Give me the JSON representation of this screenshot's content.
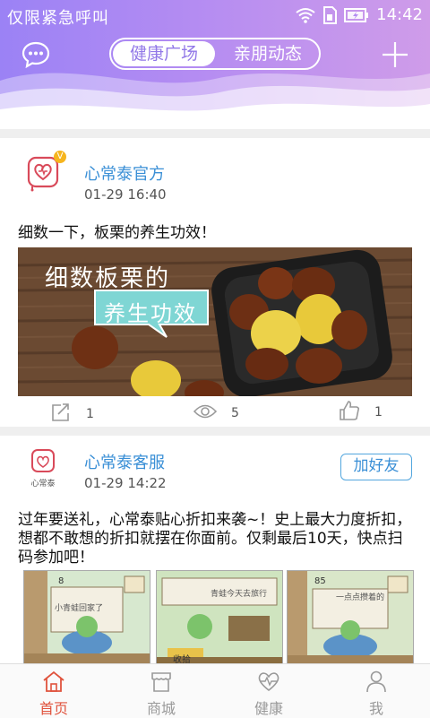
{
  "status_bar": {
    "title": "仅限紧急呼叫",
    "time": "14:42"
  },
  "header": {
    "tabs": [
      {
        "label": "健康广场",
        "active": true
      },
      {
        "label": "亲朋动态",
        "active": false
      }
    ],
    "accent_color": "#9279e8"
  },
  "posts": [
    {
      "author": "心常泰官方",
      "verified_badge": "V",
      "time": "01-29 16:40",
      "text": "细数一下，板栗的养生功效！",
      "image_title": "细数板栗的",
      "image_tag": "养生功效",
      "share_count": "1",
      "view_count": "5",
      "like_count": "1"
    },
    {
      "author": "心常泰客服",
      "avatar_caption": "心常泰",
      "time": "01-29 14:22",
      "follow_label": "加好友",
      "text": "过年要送礼，心常泰贴心折扣来袭~！史上最大力度折扣，想都不敢想的折扣就摆在你面前。仅剩最后10天，快点扫码参加吧！",
      "thumbs": [
        {
          "count": "8",
          "bubble": "小青蛙回家了"
        },
        {
          "count": "",
          "bubble": "青蛙今天去旅行",
          "tag": "收拾"
        },
        {
          "count": "85",
          "bubble": "一点点攒着的"
        }
      ]
    }
  ],
  "bottom_nav": [
    {
      "label": "首页",
      "icon": "home-icon",
      "active": true
    },
    {
      "label": "商城",
      "icon": "shop-icon",
      "active": false
    },
    {
      "label": "健康",
      "icon": "heart-pulse-icon",
      "active": false
    },
    {
      "label": "我",
      "icon": "person-icon",
      "active": false
    }
  ],
  "colors": {
    "link_blue": "#3a8fd6",
    "nav_active": "#e0533d",
    "badge": "#f6b51e"
  }
}
